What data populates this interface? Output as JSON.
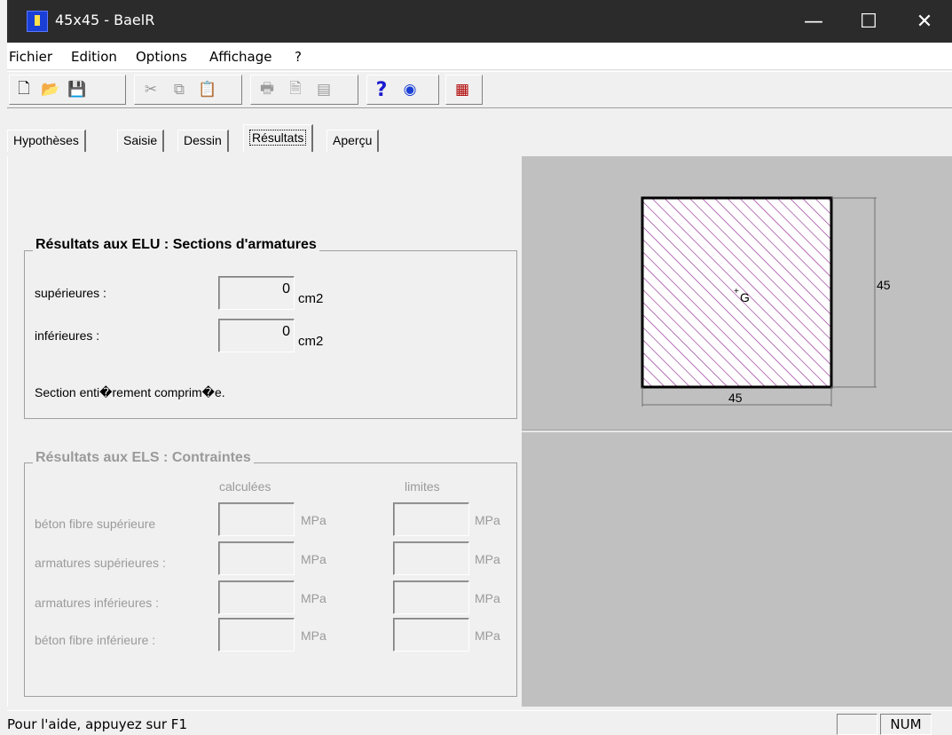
{
  "window": {
    "title": "45x45 - BaelR",
    "minimize": "—",
    "maximize": "☐",
    "close": "✕"
  },
  "menu": [
    "Fichier",
    "Edition",
    "Options",
    "Affichage",
    "?"
  ],
  "tabs": [
    "Hypothèses",
    "Saisie",
    "Dessin",
    "Résultats",
    "Aperçu"
  ],
  "elu": {
    "title": "Résultats aux ELU : Sections d'armatures",
    "sup_label": "supérieures :",
    "sup_value": "0",
    "inf_label": "inférieures :",
    "inf_value": "0",
    "unit": "cm2",
    "message": "Section enti�rement comprim�e."
  },
  "els": {
    "title": "Résultats aux ELS : Contraintes",
    "col_calc": "calculées",
    "col_lim": "limites",
    "unit": "MPa",
    "rows": [
      "béton fibre supérieure",
      "armatures supérieures :",
      "armatures inférieures :",
      "béton fibre inférieure :"
    ]
  },
  "drawing": {
    "width_label": "45",
    "height_label": "45",
    "centroid_label": "G",
    "hatch_color": "#8b1c8b"
  },
  "status": {
    "message": "Pour l'aide, appuyez sur F1",
    "indicator": "NUM"
  }
}
